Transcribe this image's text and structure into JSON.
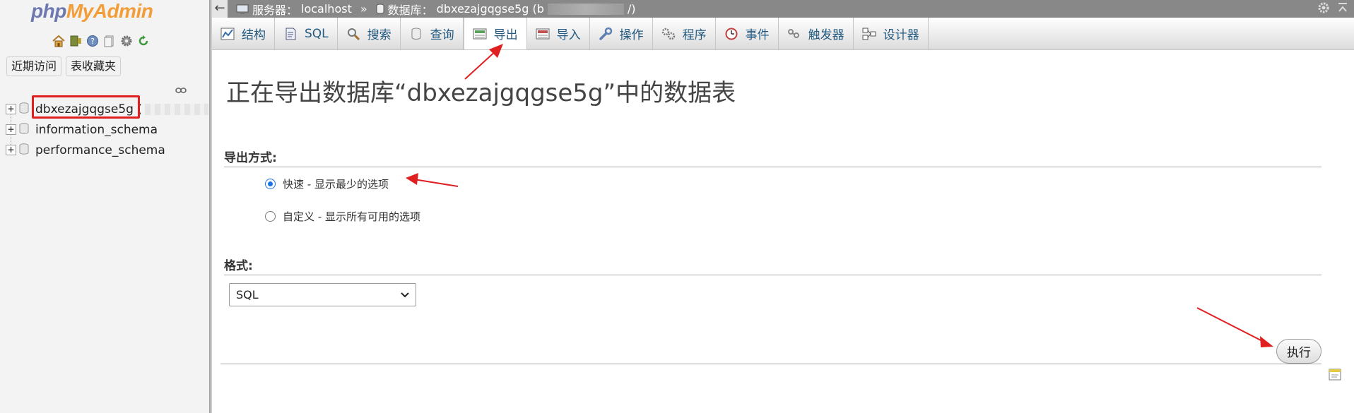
{
  "nav": {
    "logo": {
      "part1": "php",
      "part2": "My",
      "part3": "Admin"
    },
    "icons": [
      "home-icon",
      "exit-icon",
      "help-icon",
      "docs-icon",
      "settings-icon",
      "reload-icon"
    ],
    "recent_button": "近期访问",
    "favorites_button": "表收藏夹",
    "databases": [
      {
        "name": "dbxezajgqgse5g (",
        "highlighted": true
      },
      {
        "name": "information_schema",
        "highlighted": false
      },
      {
        "name": "performance_schema",
        "highlighted": false
      }
    ]
  },
  "topbar": {
    "back": "←",
    "server_label": "服务器：",
    "server_value": "localhost",
    "separator": "»",
    "db_label": "数据库：",
    "db_value": "dbxezajgqgse5g (b",
    "db_value_tail": "/)"
  },
  "tabs": [
    {
      "label": "结构",
      "icon": "structure-icon"
    },
    {
      "label": "SQL",
      "icon": "sql-icon"
    },
    {
      "label": "搜索",
      "icon": "search-icon"
    },
    {
      "label": "查询",
      "icon": "query-icon"
    },
    {
      "label": "导出",
      "icon": "export-icon",
      "active": true
    },
    {
      "label": "导入",
      "icon": "import-icon"
    },
    {
      "label": "操作",
      "icon": "wrench-icon"
    },
    {
      "label": "程序",
      "icon": "routines-icon"
    },
    {
      "label": "事件",
      "icon": "clock-icon"
    },
    {
      "label": "触发器",
      "icon": "trigger-icon"
    },
    {
      "label": "设计器",
      "icon": "designer-icon"
    }
  ],
  "main": {
    "title": "正在导出数据库“dbxezajgqgse5g”中的数据表",
    "method_heading": "导出方式:",
    "method_options": [
      {
        "label": "快速 - 显示最少的选项",
        "checked": true
      },
      {
        "label": "自定义 - 显示所有可用的选项",
        "checked": false
      }
    ],
    "format_heading": "格式:",
    "format_selected": "SQL",
    "go_button": "执行"
  },
  "colors": {
    "accent_red": "#e02020",
    "link_blue": "#235a81",
    "logo_orange": "#f29d38",
    "logo_blue": "#6c78af"
  }
}
